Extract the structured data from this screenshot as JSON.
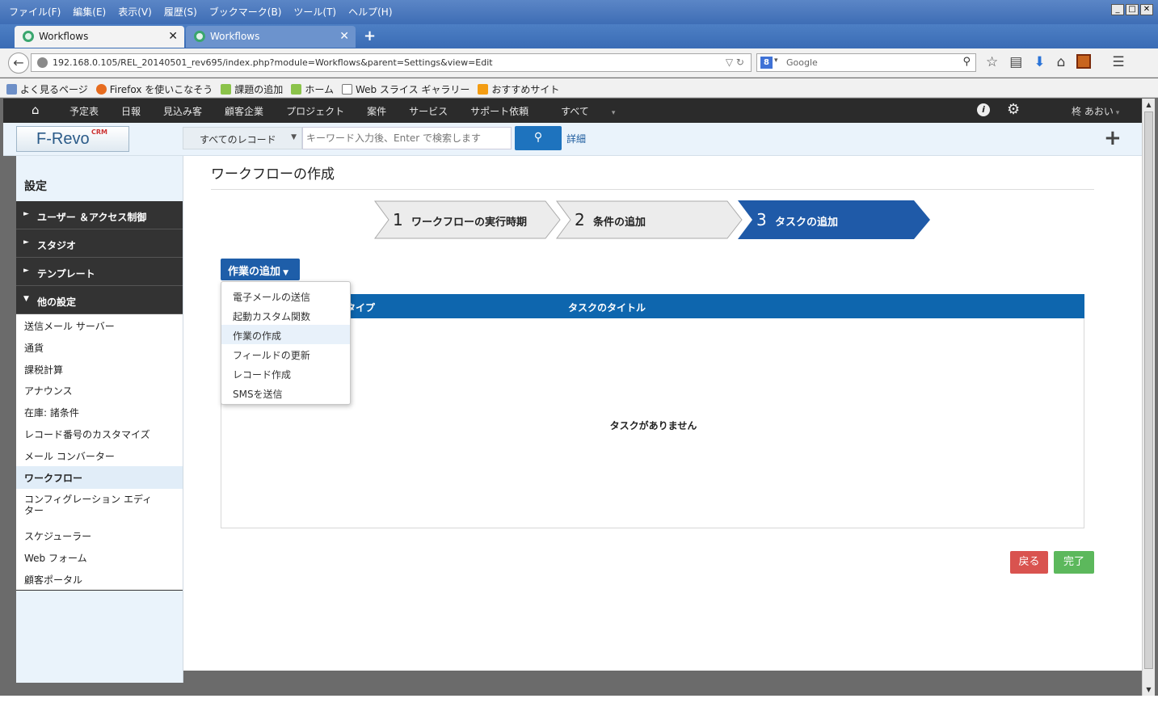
{
  "browser": {
    "menu": [
      "ファイル(F)",
      "編集(E)",
      "表示(V)",
      "履歴(S)",
      "ブックマーク(B)",
      "ツール(T)",
      "ヘルプ(H)"
    ],
    "tabs": [
      {
        "title": "Workflows"
      },
      {
        "title": "Workflows"
      }
    ],
    "url": "192.168.0.105/REL_20140501_rev695/index.php?module=Workflows&parent=Settings&view=Edit",
    "search_placeholder": "Google",
    "bookmarks": [
      "よく見るページ",
      "Firefox を使いこなそう",
      "課題の追加",
      "ホーム",
      "Web スライス ギャラリー",
      "おすすめサイト"
    ]
  },
  "app": {
    "nav": [
      "予定表",
      "日報",
      "見込み客",
      "顧客企業",
      "プロジェクト",
      "案件",
      "サービス",
      "サポート依頼",
      "すべて"
    ],
    "user": "柊 あおい",
    "logo_text": "F-Revo",
    "logo_badge": "CRM",
    "record_select": "すべてのレコード",
    "search_placeholder": "キーワード入力後、Enter で検索します",
    "detail_link": "詳細"
  },
  "sidebar": {
    "title": "設定",
    "sections": [
      "ユーザー ＆アクセス制御",
      "スタジオ",
      "テンプレート",
      "他の設定"
    ],
    "items": [
      "送信メール サーバー",
      "通貨",
      "課税計算",
      "アナウンス",
      "在庫: 諸条件",
      "レコード番号のカスタマイズ",
      "メール コンバーター",
      "ワークフロー",
      "コンフィグレーション エディ\nター",
      "スケジューラー",
      "Web フォーム",
      "顧客ポータル"
    ],
    "active_index": 7
  },
  "main": {
    "title": "ワークフローの作成",
    "steps": [
      {
        "num": "1",
        "label": "ワークフローの実行時期"
      },
      {
        "num": "2",
        "label": "条件の追加"
      },
      {
        "num": "3",
        "label": "タスクの追加"
      }
    ],
    "add_task_button": "作業の追加",
    "dropdown": [
      "電子メールの送信",
      "起動カスタム関数",
      "作業の作成",
      "フィールドの更新",
      "レコード作成",
      "SMSを送信"
    ],
    "highlighted_option": 2,
    "table_headers": [
      "タイプ",
      "タスクのタイトル"
    ],
    "empty_message": "タスクがありません",
    "back_button": "戻る",
    "done_button": "完了"
  },
  "colors": {
    "primary": "#1e5ea9",
    "step_active": "#1f5aa8",
    "back": "#d9534f",
    "done": "#5cb85c"
  }
}
